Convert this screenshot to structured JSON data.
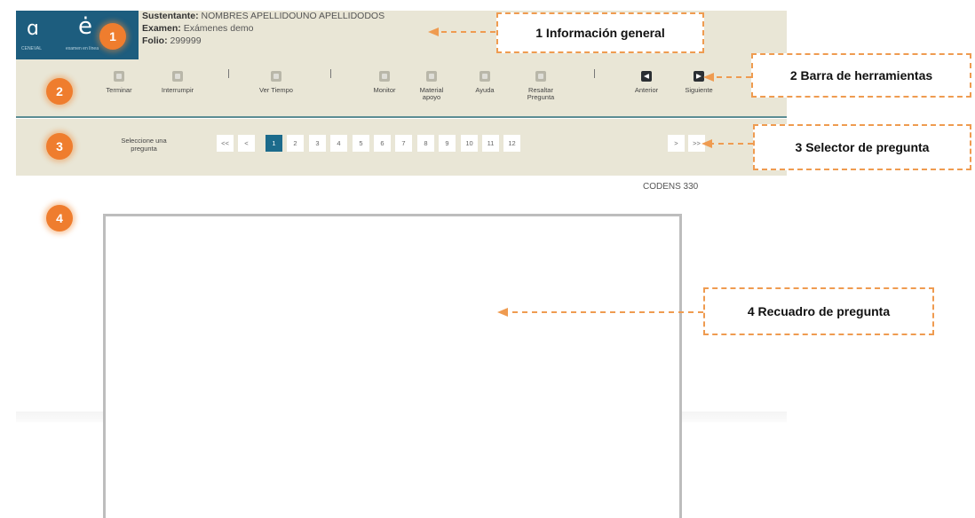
{
  "header": {
    "logo_a": "ɑ",
    "logo_a_caption": "CENEVAL",
    "logo_e": "ė",
    "logo_e_caption": "examen en línea",
    "sustentante_label": "Sustentante:",
    "sustentante_value": "NOMBRES APELLIDOUNO APELLIDODOS",
    "examen_label": "Examen:",
    "examen_value": "Exámenes demo",
    "folio_label": "Folio:",
    "folio_value": "299999"
  },
  "badges": [
    "1",
    "2",
    "3",
    "4"
  ],
  "toolbar": {
    "terminar": "Terminar",
    "interrumpir": "Interrumpir",
    "ver_tiempo": "Ver Tiempo",
    "monitor": "Monitor",
    "material_apoyo": "Material apoyo",
    "ayuda": "Ayuda",
    "resaltar_pregunta": "Resaltar Pregunta",
    "anterior": "Anterior",
    "siguiente": "Siguiente",
    "separator": "|"
  },
  "selector": {
    "label": "Seleccione una pregunta",
    "first": "<<",
    "prev": "<",
    "pages": [
      "1",
      "2",
      "3",
      "4",
      "5",
      "6",
      "7",
      "8",
      "9",
      "10",
      "11",
      "12"
    ],
    "active_page": "1",
    "next": ">",
    "last": ">>"
  },
  "codens": "CODENS 330",
  "callouts": {
    "c1": "1 Información general",
    "c2": "2 Barra de herramientas",
    "c3": "3 Selector de pregunta",
    "c4": "4 Recuadro de pregunta"
  },
  "colors": {
    "badge": "#ef7d2e",
    "callout_border": "#ef9b50",
    "panel_bg": "#e9e6d6",
    "active_page": "#1c6b8c",
    "logo_bg": "#1d5d7e"
  }
}
